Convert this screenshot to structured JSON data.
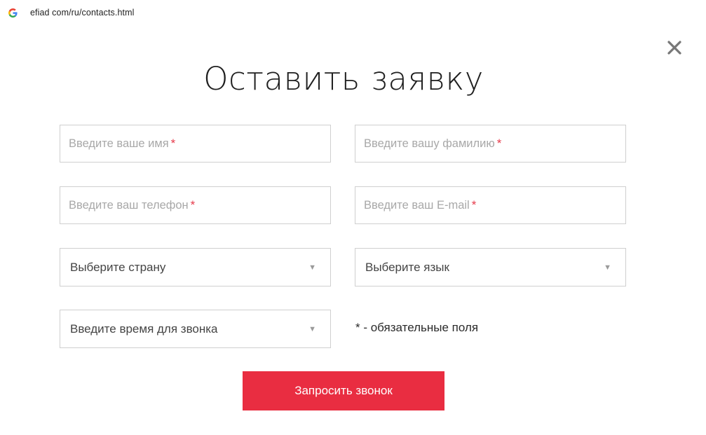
{
  "browser": {
    "url": "efiad com/ru/contacts.html",
    "favicon": "google-g-icon"
  },
  "modal": {
    "title": "Оставить заявку",
    "close_icon": "close-icon",
    "fields": {
      "first_name": {
        "placeholder": "Введите ваше имя",
        "required_mark": "*"
      },
      "last_name": {
        "placeholder": "Введите вашу фамилию",
        "required_mark": "*"
      },
      "phone": {
        "placeholder": "Введите ваш телефон",
        "required_mark": "*"
      },
      "email": {
        "placeholder": "Введите ваш E-mail",
        "required_mark": "*"
      }
    },
    "selects": {
      "country": {
        "value": "Выберите страну",
        "arrow": "▼"
      },
      "language": {
        "value": "Выберите язык",
        "arrow": "▼"
      },
      "call_time": {
        "value": "Введите время для звонка",
        "arrow": "▼"
      }
    },
    "required_note": "* - обязательные поля",
    "submit_label": "Запросить звонок",
    "colors": {
      "accent": "#e92d41",
      "required_mark": "#e63a4a",
      "border": "#cfcfcf",
      "placeholder": "#a8a8a8"
    }
  }
}
